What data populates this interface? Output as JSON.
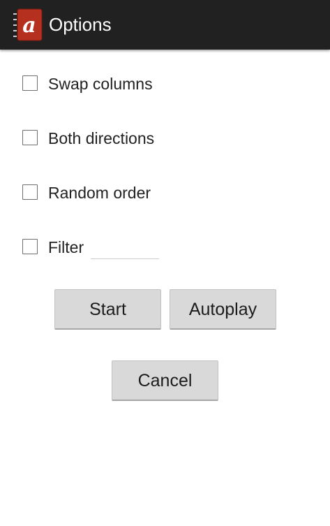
{
  "action_bar": {
    "title": "Options",
    "icon": "app-logo-icon",
    "background_color": "#212121"
  },
  "options": {
    "swap_columns": {
      "label": "Swap columns",
      "checked": false
    },
    "both_directions": {
      "label": "Both directions",
      "checked": false
    },
    "random_order": {
      "label": "Random order",
      "checked": false
    },
    "filter": {
      "label": "Filter",
      "checked": false,
      "value": ""
    }
  },
  "buttons": {
    "start": "Start",
    "autoplay": "Autoplay",
    "cancel": "Cancel"
  },
  "colors": {
    "accent": "#c0392b",
    "button_background": "#d9d9d9"
  }
}
